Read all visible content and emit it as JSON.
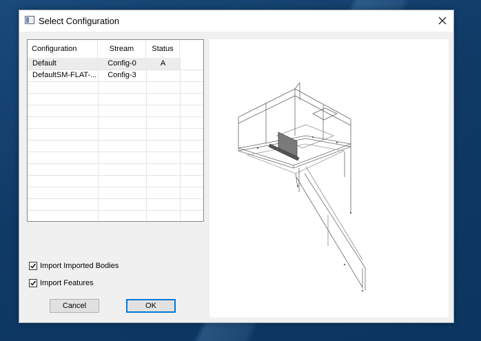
{
  "dialog": {
    "title": "Select Configuration",
    "close_icon": "close-icon",
    "app_icon": "dialog-app-icon"
  },
  "config_list": {
    "columns": [
      "Configuration",
      "Stream",
      "Status"
    ],
    "rows": [
      {
        "configuration": "Default",
        "stream": "Config-0",
        "status": "A"
      },
      {
        "configuration": "DefaultSM-FLAT-...",
        "stream": "Config-3",
        "status": ""
      }
    ]
  },
  "options": {
    "import_imported_bodies": {
      "label": "Import Imported Bodies",
      "checked": true
    },
    "import_features": {
      "label": "Import Features",
      "checked": true
    }
  },
  "buttons": {
    "cancel": "Cancel",
    "ok": "OK"
  },
  "colors": {
    "accent": "#0078d7",
    "desktop": "#0f3a66"
  }
}
